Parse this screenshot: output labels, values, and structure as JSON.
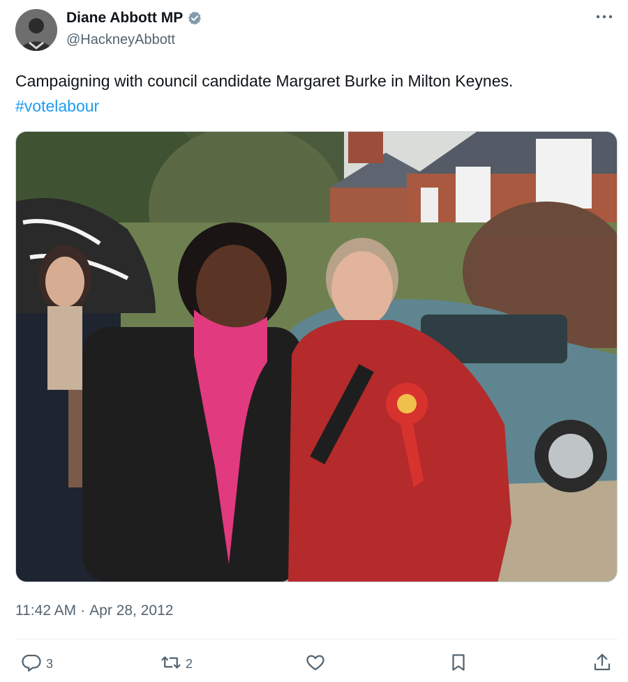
{
  "user": {
    "display_name": "Diane Abbott MP",
    "handle": "@HackneyAbbott",
    "verified": true
  },
  "tweet": {
    "text": "Campaigning with council candidate Margaret Burke in Milton Keynes.",
    "hashtag": "#votelabour",
    "time": "11:42 AM",
    "separator": "·",
    "date": "Apr 28, 2012"
  },
  "actions": {
    "reply_count": "3",
    "retweet_count": "2",
    "like_count": "",
    "bookmark_count": "",
    "share_count": ""
  },
  "icons": {
    "more": "more-icon",
    "reply": "reply-icon",
    "retweet": "retweet-icon",
    "like": "heart-icon",
    "bookmark": "bookmark-icon",
    "share": "share-icon",
    "verified": "verified-badge-icon"
  },
  "colors": {
    "link": "#1d9bf0",
    "secondary_text": "#536471",
    "primary_text": "#0f1419",
    "verified_badge": "#829aab"
  }
}
